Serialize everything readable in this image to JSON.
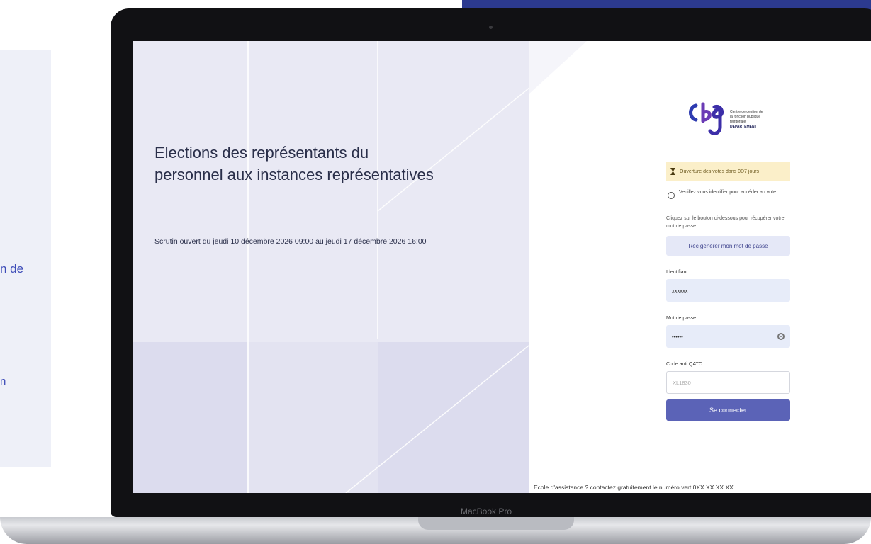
{
  "background": {
    "card_text_1": "n de",
    "card_text_2": "n"
  },
  "laptop": {
    "brand": "MacBook Pro"
  },
  "event": {
    "title": "Elections des représentants du personnel aux instances représentatives",
    "dates": "Scrutin ouvert du jeudi 10 décembre 2026 09:00 au jeudi 17 décembre 2026 16:00"
  },
  "login": {
    "logo_text_lines": [
      "Centre de gestion de",
      "la fonction publique",
      "territoriale",
      "DEPARTEMENT"
    ],
    "notice": "Ouverture des votes dans 0D7 jours",
    "info": "Veuillez vous identifier pour accéder au vote",
    "hint": "Cliquez sur le bouton ci-dessous pour récupérer votre mot de passe :",
    "generate_button": "Réc générer mon mot de passe",
    "identifier_label": "Identifiant :",
    "identifier_value": "xxxxxx",
    "password_label": "Mot de passe :",
    "password_value": "••••••",
    "captcha_label": "Code anti QATC :",
    "captcha_placeholder": "XL1830",
    "connect_button": "Se connecter"
  },
  "assistance": "Ecole d'assistance ? contactez gratuitement le numéro vert 0XX XX XX XX"
}
